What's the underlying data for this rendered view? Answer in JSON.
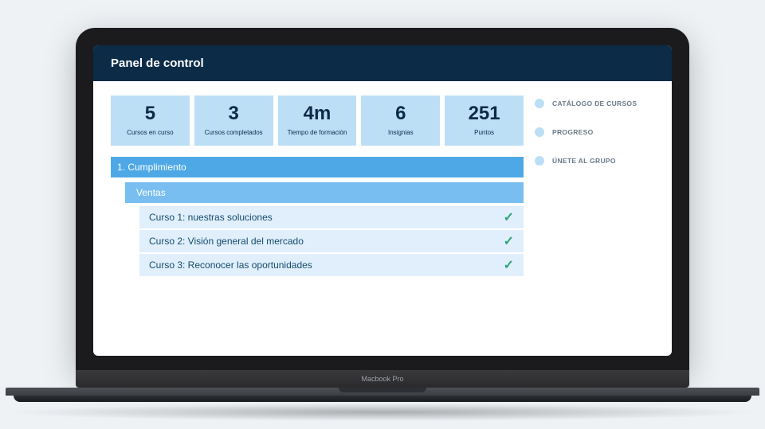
{
  "header": {
    "title": "Panel de control"
  },
  "stats": [
    {
      "value": "5",
      "label": "Cursos en curso"
    },
    {
      "value": "3",
      "label": "Cursos completados"
    },
    {
      "value": "4m",
      "label": "Tiempo de formación"
    },
    {
      "value": "6",
      "label": "Insignias"
    },
    {
      "value": "251",
      "label": "Puntos"
    }
  ],
  "section": {
    "title": "1. Cumplimiento"
  },
  "subsection": {
    "title": "Ventas"
  },
  "courses": [
    {
      "title": "Curso 1: nuestras soluciones"
    },
    {
      "title": "Curso 2: Visión general del mercado"
    },
    {
      "title": "Curso 3: Reconocer las oportunidades"
    }
  ],
  "sidebar": {
    "items": [
      {
        "label": "CATÁLOGO DE CURSOS"
      },
      {
        "label": "PROGRESO"
      },
      {
        "label": "ÚNETE AL GRUPO"
      }
    ]
  },
  "device": {
    "label": "Macbook Pro"
  }
}
